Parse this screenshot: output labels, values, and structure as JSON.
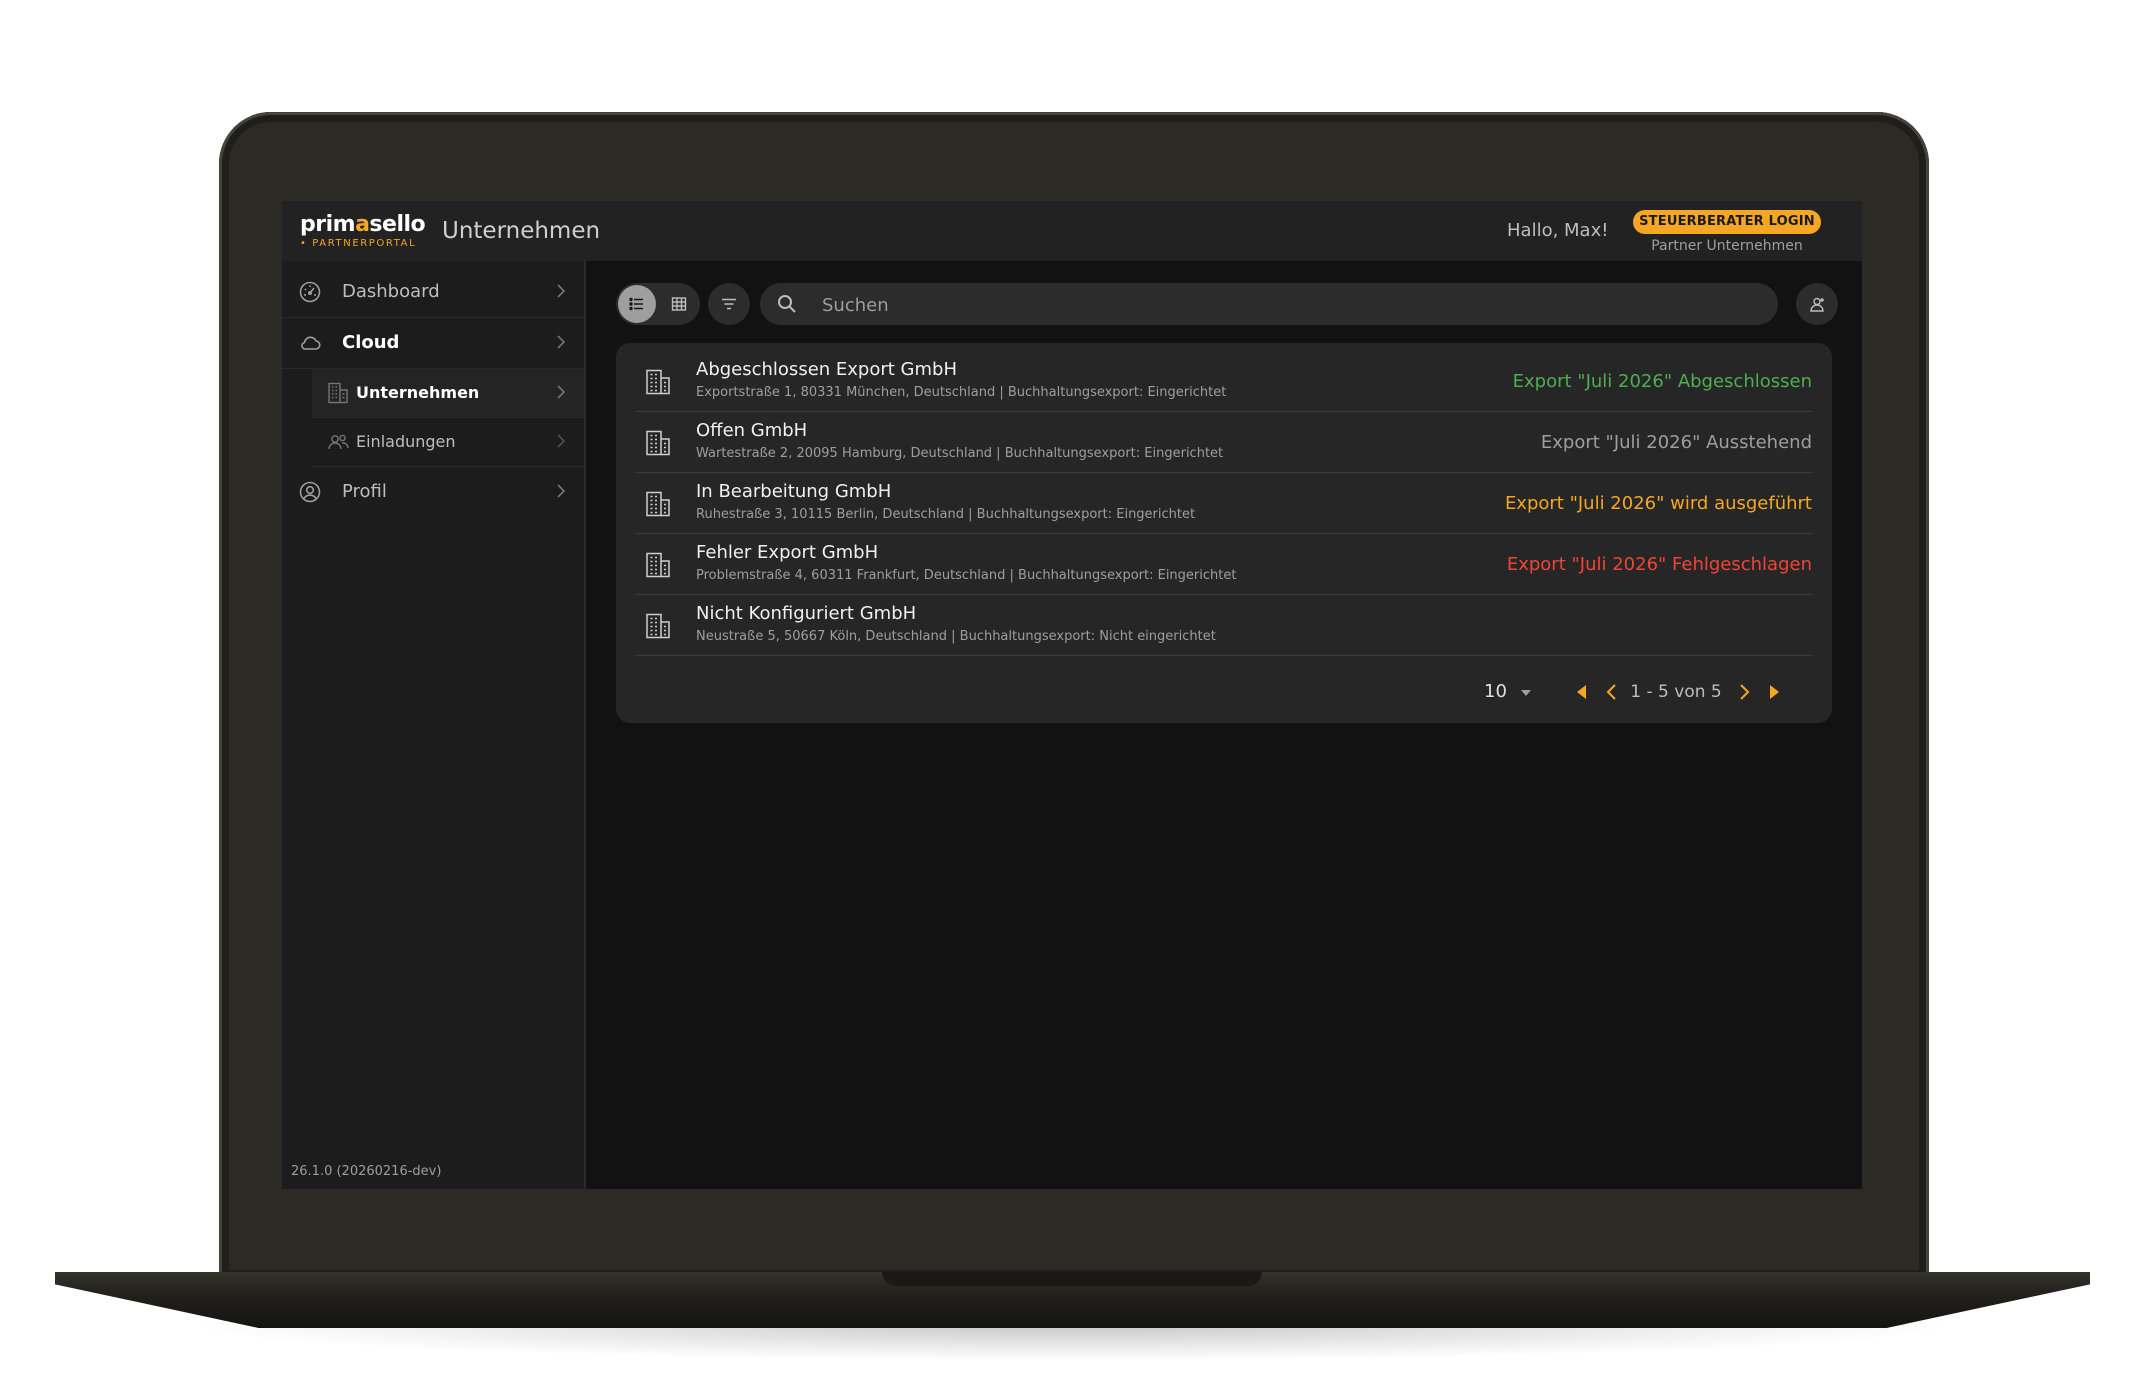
{
  "colors": {
    "accent": "#f5a623",
    "status_done": "#4caf50",
    "status_pending": "#9e9e9e",
    "status_running": "#f5a623",
    "status_error": "#f44336"
  },
  "brand": {
    "logo_name": "primasello",
    "logo_prefix": "prim",
    "logo_accent": "a",
    "logo_suffix": "sello",
    "logo_sub": "• PARTNERPORTAL"
  },
  "header": {
    "title": "Unternehmen",
    "greeting": "Hallo, Max!",
    "login_badge": "STEUERBERATER LOGIN",
    "partner_label": "Partner Unternehmen"
  },
  "sidebar": {
    "items": [
      {
        "label": "Dashboard",
        "icon": "speedometer-icon"
      },
      {
        "label": "Cloud",
        "icon": "cloud-icon"
      },
      {
        "label": "Unternehmen",
        "icon": "building-icon"
      },
      {
        "label": "Einladungen",
        "icon": "users-icon"
      },
      {
        "label": "Profil",
        "icon": "user-circle-icon"
      }
    ],
    "version": "26.1.0 (20260216-dev)"
  },
  "toolbar": {
    "view_modes": [
      "list-view-icon",
      "grid-view-icon"
    ],
    "filter_icon": "filter-icon",
    "search_placeholder": "Suchen",
    "search_value": "",
    "invite_icon": "add-user-icon"
  },
  "companies": [
    {
      "name": "Abgeschlossen Export GmbH",
      "address": "Exportstraße 1, 80331 München, Deutschland | Buchhaltungsexport: Eingerichtet",
      "status": "Export \"Juli 2026\" Abgeschlossen",
      "status_color": "#4caf50"
    },
    {
      "name": "Offen GmbH",
      "address": "Wartestraße 2, 20095 Hamburg, Deutschland | Buchhaltungsexport: Eingerichtet",
      "status": "Export \"Juli 2026\" Ausstehend",
      "status_color": "#9e9e9e"
    },
    {
      "name": "In Bearbeitung GmbH",
      "address": "Ruhestraße 3, 10115 Berlin, Deutschland | Buchhaltungsexport: Eingerichtet",
      "status": "Export \"Juli 2026\" wird ausgeführt",
      "status_color": "#f5a623"
    },
    {
      "name": "Fehler Export GmbH",
      "address": "Problemstraße 4, 60311 Frankfurt, Deutschland | Buchhaltungsexport: Eingerichtet",
      "status": "Export \"Juli 2026\" Fehlgeschlagen",
      "status_color": "#f44336"
    },
    {
      "name": "Nicht Konfiguriert GmbH",
      "address": "Neustraße 5, 50667 Köln, Deutschland | Buchhaltungsexport: Nicht eingerichtet",
      "status": "",
      "status_color": "#9e9e9e"
    }
  ],
  "pagination": {
    "per_page": "10",
    "range": "1 - 5 von 5"
  }
}
